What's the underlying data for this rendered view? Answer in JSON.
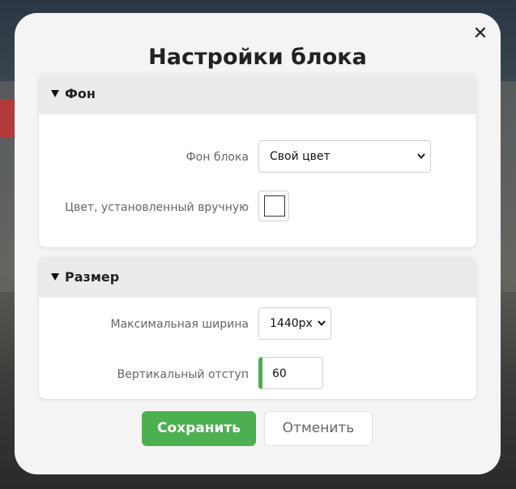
{
  "dialog": {
    "title": "Настройки блока",
    "close_icon": "✕"
  },
  "background_section": {
    "title": "Фон",
    "block_bg_label": "Фон блока",
    "block_bg_value": "Свой цвет",
    "custom_color_label": "Цвет, установленный вручную",
    "custom_color_value": "#ffffff"
  },
  "size_section": {
    "title": "Размер",
    "max_width_label": "Максимальная ширина",
    "max_width_value": "1440px",
    "vertical_padding_label": "Вертикальный отступ",
    "vertical_padding_value": "60"
  },
  "actions": {
    "save_label": "Сохранить",
    "cancel_label": "Отменить"
  },
  "colors": {
    "accent": "#4caf50",
    "modal_bg": "#f4f4f4",
    "section_header_bg": "#ebebeb"
  },
  "icons": {
    "close": "close-icon",
    "section_toggle": "triangle-down-icon",
    "select_arrow": "chevron-down-icon"
  }
}
